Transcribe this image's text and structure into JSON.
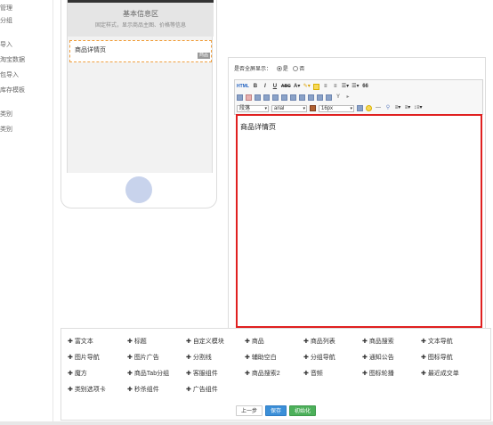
{
  "sidebar": {
    "items": [
      "管理",
      "分组",
      "导入",
      "淘宝数据",
      "包导入",
      "库存模板",
      "类别",
      "类别"
    ]
  },
  "phone": {
    "basic_title": "基本信息区",
    "basic_sub": "固定样式，显示商品主图、价格等信息",
    "detail_label": "商品详情页",
    "detail_tag": "商品"
  },
  "editor": {
    "fullscreen_label": "是否全屏显示：",
    "yes": "是",
    "no": "否",
    "para_select": "段落",
    "font_select": "arial",
    "size_select": "16px",
    "content": "商品详情页"
  },
  "components": [
    [
      "富文本",
      "标题",
      "自定义模块",
      "商品",
      "商品列表",
      "商品搜索",
      "文本导航"
    ],
    [
      "图片导航",
      "图片广告",
      "分割线",
      "辅助空白",
      "分组导航",
      "通知公告",
      "图标导航"
    ],
    [
      "魔方",
      "商品Tab分组",
      "客服组件",
      "商品搜索2",
      "音频",
      "图标轮播",
      "最近成交单"
    ],
    [
      "类别选项卡",
      "秒杀组件",
      "广告组件"
    ]
  ],
  "buttons": {
    "prev": "上一步",
    "save": "保存",
    "init": "初始化"
  }
}
